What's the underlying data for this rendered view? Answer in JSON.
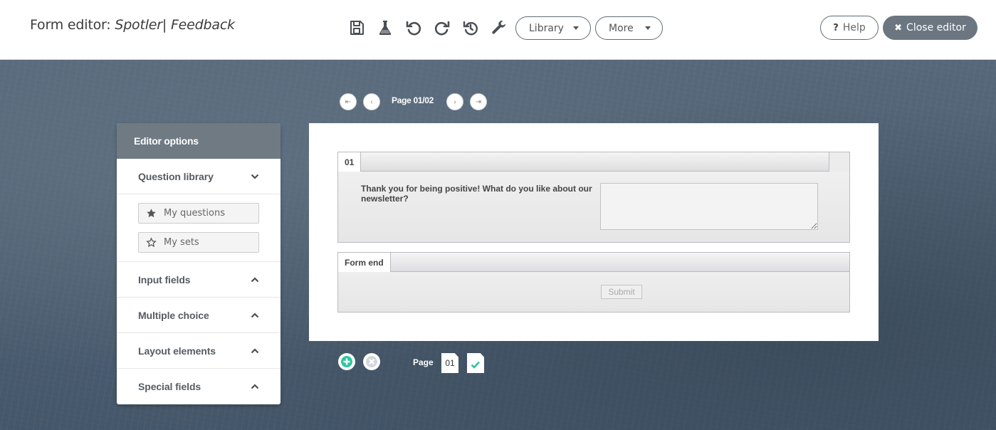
{
  "header": {
    "title_prefix": "Form editor:",
    "form_name": "Spotler| Feedback",
    "library_label": "Library",
    "more_label": "More",
    "help_label": "Help",
    "help_icon": "?",
    "close_label": "Close editor",
    "close_icon": "✖",
    "toolbar_icons": [
      "save-icon",
      "test-flask-icon",
      "undo-icon",
      "redo-icon",
      "history-icon",
      "settings-wrench-icon"
    ]
  },
  "pager": {
    "label": "Page 01/02",
    "first": "⇤",
    "prev": "‹",
    "next": "›",
    "last": "⇥"
  },
  "sidebar": {
    "title": "Editor options",
    "question_library": "Question library",
    "my_questions": "My questions",
    "my_sets": "My sets",
    "sections": [
      "Input fields",
      "Multiple choice",
      "Layout elements",
      "Special fields"
    ]
  },
  "form": {
    "question_block": {
      "number": "01",
      "question": "Thank you for being positive! What do you like about our newsletter?",
      "answer": ""
    },
    "end_block": {
      "tag": "Form end",
      "submit_label": "Submit"
    }
  },
  "pages": {
    "label": "Page",
    "current": "01"
  },
  "colors": {
    "accent_green": "#2ec5a0",
    "close_button": "#6b7680",
    "sidebar_header": "#6f7a83"
  }
}
